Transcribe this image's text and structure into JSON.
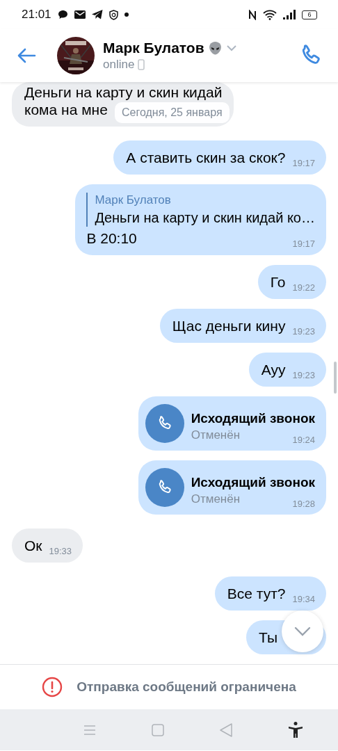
{
  "status_bar": {
    "time": "21:01",
    "battery": "6"
  },
  "header": {
    "name": "Марк Булатов",
    "status": "online"
  },
  "date_divider": "Сегодня, 25 января",
  "messages": [
    {
      "kind": "text",
      "outgoing": false,
      "lines": [
        "Деньги на карту и скин кидай",
        "кома на мне"
      ]
    },
    {
      "kind": "text",
      "outgoing": true,
      "text": "А ставить скин за скок?",
      "time": "19:17"
    },
    {
      "kind": "reply",
      "outgoing": true,
      "quote_author": "Марк Булатов",
      "quote_text": "Деньги на карту и скин кидай ко…",
      "text": "В 20:10",
      "time": "19:17"
    },
    {
      "kind": "text",
      "outgoing": true,
      "text": "Го",
      "time": "19:22"
    },
    {
      "kind": "text",
      "outgoing": true,
      "text": "Щас деньги кину",
      "time": "19:23"
    },
    {
      "kind": "text",
      "outgoing": true,
      "text": "Ауу",
      "time": "19:23"
    },
    {
      "kind": "call",
      "outgoing": true,
      "title": "Исходящий звонок",
      "status": "Отменён",
      "time": "19:24"
    },
    {
      "kind": "call",
      "outgoing": true,
      "title": "Исходящий звонок",
      "status": "Отменён",
      "time": "19:28"
    },
    {
      "kind": "text",
      "outgoing": false,
      "text": "Ок",
      "time": "19:33"
    },
    {
      "kind": "text",
      "outgoing": true,
      "text": "Все тут?",
      "time": "19:34"
    },
    {
      "kind": "text",
      "outgoing": true,
      "text": "Ты"
    }
  ],
  "footer": {
    "notice": "Отправка сообщений ограничена"
  }
}
